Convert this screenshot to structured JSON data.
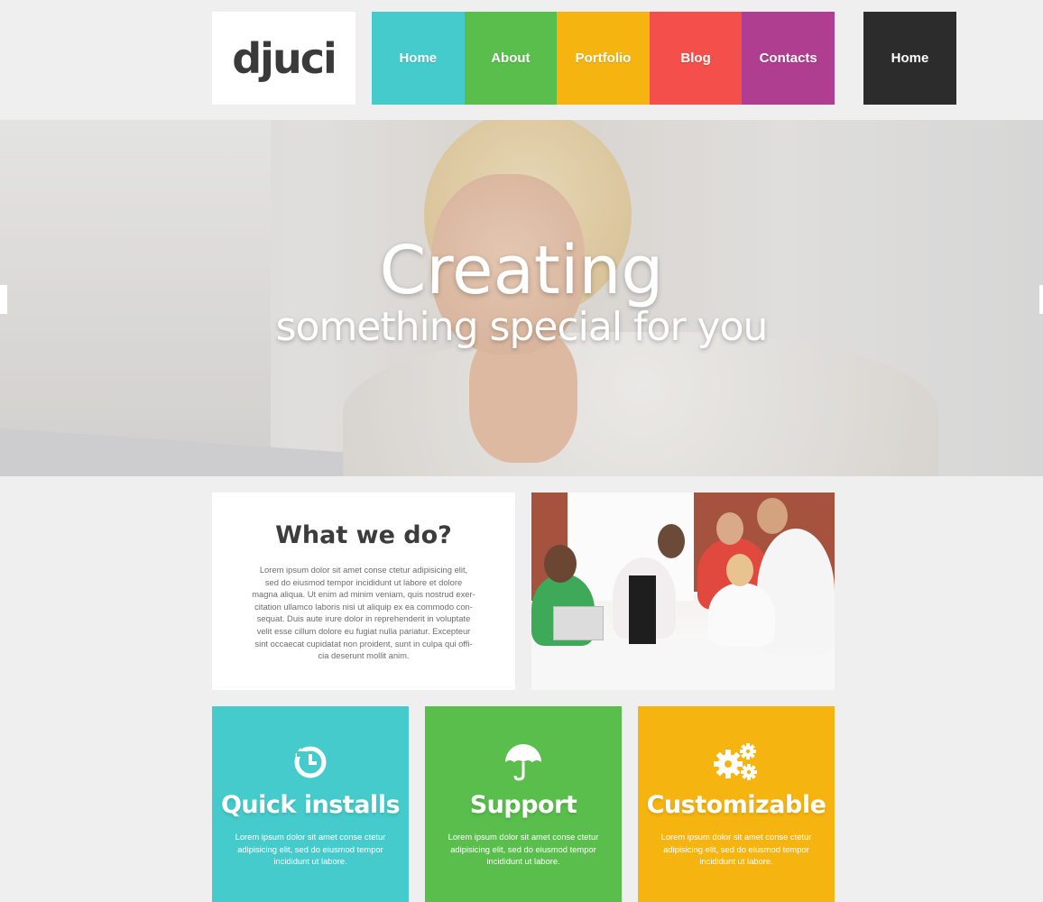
{
  "logo": {
    "text": "djuci"
  },
  "nav": {
    "items": [
      {
        "label": "Home",
        "color": "#45cbcb"
      },
      {
        "label": "About",
        "color": "#59be4b"
      },
      {
        "label": "Portfolio",
        "color": "#f6b411"
      },
      {
        "label": "Blog",
        "color": "#f44f4b"
      },
      {
        "label": "Contacts",
        "color": "#b03e90"
      }
    ],
    "right_button": {
      "label": "Home",
      "color": "#2c2c2c"
    }
  },
  "hero": {
    "title": "Creating",
    "subtitle": "something special for you"
  },
  "about": {
    "title": "What we do?",
    "text": "Lorem ipsum dolor sit amet conse ctetur adipisicing elit, sed do eiusmod tempor incididunt ut labore et dolore magna aliqua. Ut enim ad minim veniam, quis nostrud exer-citation ullamco laboris nisi ut aliquip ex ea commodo con-sequat. Duis aute irure dolor in reprehenderit in voluptate velit esse cillum dolore eu fugiat nulla pariatur. Excepteur sint occaecat cupidatat non proident, sunt in culpa qui offi-cia deserunt mollit anim."
  },
  "features": [
    {
      "title": "Quick installs",
      "icon": "history-clock-icon",
      "color": "#45cbcb",
      "text": "Lorem ipsum dolor sit amet conse ctetur adipisicing elit, sed do eiusmod tempor incididunt ut labore."
    },
    {
      "title": "Support",
      "icon": "umbrella-icon",
      "color": "#59be4b",
      "text": "Lorem ipsum dolor sit amet conse ctetur adipisicing elit, sed do eiusmod tempor incididunt ut labore."
    },
    {
      "title": "Customizable",
      "icon": "gears-icon",
      "color": "#f6b411",
      "text": "Lorem ipsum dolor sit amet conse ctetur adipisicing elit, sed do eiusmod tempor incididunt ut labore."
    }
  ]
}
